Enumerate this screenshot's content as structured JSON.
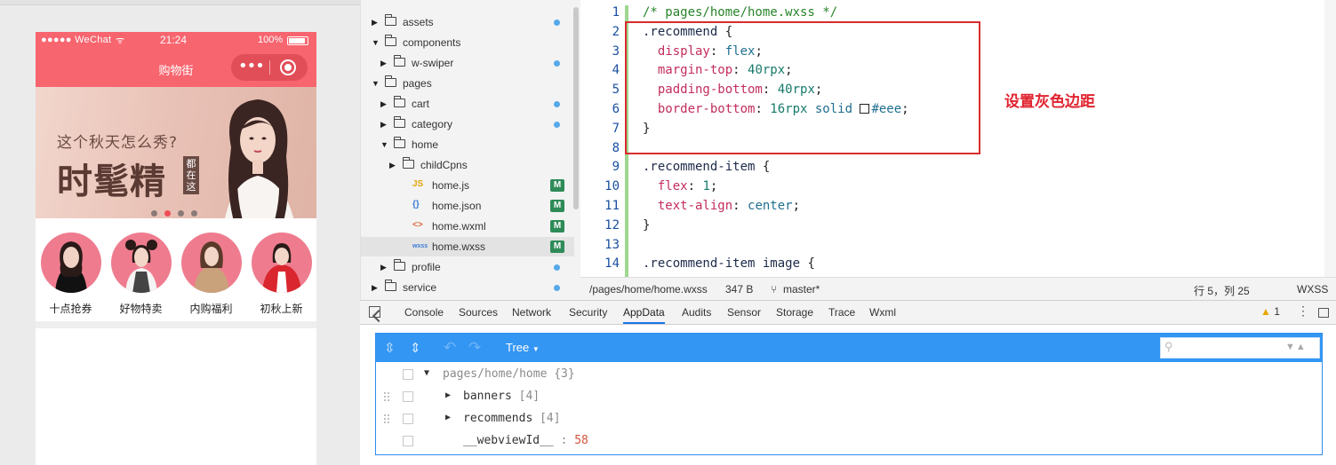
{
  "simulator": {
    "status_bar": {
      "carrier": "●●●●● WeChat",
      "wifi": "ᯤ",
      "time": "21:24",
      "battery_pct": "100%"
    },
    "nav_title": "购物街",
    "capsule": {
      "more": "•••"
    },
    "banner": {
      "subtitle": "这个秋天怎么秀?",
      "headline": "时髦精",
      "vertical_text": "都在这",
      "active_dot": 1,
      "dot_count": 4
    },
    "recommends": [
      {
        "label": "十点抢券"
      },
      {
        "label": "好物特卖"
      },
      {
        "label": "内购福利"
      },
      {
        "label": "初秋上新"
      }
    ],
    "colors": {
      "brand": "#f7656f",
      "recommend_avatar_bg": "#ef7c8e"
    }
  },
  "file_tree": {
    "items": [
      {
        "name": "assets",
        "type": "folder",
        "expanded": false,
        "indent": 0,
        "dot": true
      },
      {
        "name": "components",
        "type": "folder",
        "expanded": true,
        "indent": 0,
        "dot": false
      },
      {
        "name": "w-swiper",
        "type": "folder",
        "expanded": false,
        "indent": 1,
        "dot": true
      },
      {
        "name": "pages",
        "type": "folder",
        "expanded": true,
        "indent": 0,
        "dot": false
      },
      {
        "name": "cart",
        "type": "folder",
        "expanded": false,
        "indent": 1,
        "dot": true
      },
      {
        "name": "category",
        "type": "folder",
        "expanded": false,
        "indent": 1,
        "dot": true
      },
      {
        "name": "home",
        "type": "folder",
        "expanded": true,
        "indent": 1,
        "dot": false
      },
      {
        "name": "childCpns",
        "type": "folder",
        "expanded": false,
        "indent": 2,
        "dot": false
      },
      {
        "name": "home.js",
        "type": "file",
        "icon": "JS",
        "indent": 2,
        "badge": "M"
      },
      {
        "name": "home.json",
        "type": "file",
        "icon": "{}",
        "indent": 2,
        "badge": "M"
      },
      {
        "name": "home.wxml",
        "type": "file",
        "icon": "<>",
        "indent": 2,
        "badge": "M"
      },
      {
        "name": "home.wxss",
        "type": "file",
        "icon": "wxss",
        "indent": 2,
        "badge": "M",
        "selected": true
      },
      {
        "name": "profile",
        "type": "folder",
        "expanded": false,
        "indent": 1,
        "dot": true
      },
      {
        "name": "service",
        "type": "folder",
        "expanded": false,
        "indent": 0,
        "dot": true
      }
    ]
  },
  "editor": {
    "lines": [
      {
        "n": "1",
        "tokens": [
          [
            "c-comment",
            "/* pages/home/home.wxss */"
          ]
        ]
      },
      {
        "n": "2",
        "tokens": [
          [
            "c-sel",
            ".recommend "
          ],
          [
            "c-plain",
            "{"
          ]
        ]
      },
      {
        "n": "3",
        "tokens": [
          [
            "c-plain",
            "  "
          ],
          [
            "c-prop",
            "display"
          ],
          [
            "c-plain",
            ": "
          ],
          [
            "c-val",
            "flex"
          ],
          [
            "c-plain",
            ";"
          ]
        ]
      },
      {
        "n": "4",
        "tokens": [
          [
            "c-plain",
            "  "
          ],
          [
            "c-prop",
            "margin-top"
          ],
          [
            "c-plain",
            ": "
          ],
          [
            "c-num",
            "40rpx"
          ],
          [
            "c-plain",
            ";"
          ]
        ]
      },
      {
        "n": "5",
        "tokens": [
          [
            "c-plain",
            "  "
          ],
          [
            "c-prop",
            "padding-bottom"
          ],
          [
            "c-plain",
            ": "
          ],
          [
            "c-num",
            "40rpx"
          ],
          [
            "c-plain",
            ";"
          ]
        ]
      },
      {
        "n": "6",
        "tokens": [
          [
            "c-plain",
            "  "
          ],
          [
            "c-prop",
            "border-bottom"
          ],
          [
            "c-plain",
            ": "
          ],
          [
            "c-num",
            "16rpx "
          ],
          [
            "c-val",
            "solid "
          ],
          [
            "colorbox",
            ""
          ],
          [
            "c-val",
            "#eee"
          ],
          [
            "c-plain",
            ";"
          ]
        ]
      },
      {
        "n": "7",
        "tokens": [
          [
            "c-plain",
            "}"
          ]
        ]
      },
      {
        "n": "8",
        "tokens": []
      },
      {
        "n": "9",
        "tokens": [
          [
            "c-sel",
            ".recommend-item "
          ],
          [
            "c-plain",
            "{"
          ]
        ]
      },
      {
        "n": "10",
        "tokens": [
          [
            "c-plain",
            "  "
          ],
          [
            "c-prop",
            "flex"
          ],
          [
            "c-plain",
            ": "
          ],
          [
            "c-num",
            "1"
          ],
          [
            "c-plain",
            ";"
          ]
        ]
      },
      {
        "n": "11",
        "tokens": [
          [
            "c-plain",
            "  "
          ],
          [
            "c-prop",
            "text-align"
          ],
          [
            "c-plain",
            ": "
          ],
          [
            "c-val",
            "center"
          ],
          [
            "c-plain",
            ";"
          ]
        ]
      },
      {
        "n": "12",
        "tokens": [
          [
            "c-plain",
            "}"
          ]
        ]
      },
      {
        "n": "13",
        "tokens": []
      },
      {
        "n": "14",
        "tokens": [
          [
            "c-sel",
            ".recommend-item image "
          ],
          [
            "c-plain",
            "{"
          ]
        ]
      }
    ],
    "annotation": "设置灰色边距",
    "status": {
      "path": "/pages/home/home.wxss",
      "size": "347 B",
      "branch": "master*",
      "cursor": "行 5，列 25",
      "lang": "WXSS"
    }
  },
  "devtools": {
    "tabs": [
      "Console",
      "Sources",
      "Network",
      "Security",
      "AppData",
      "Audits",
      "Sensor",
      "Storage",
      "Trace",
      "Wxml"
    ],
    "active_tab": "AppData",
    "warnings": "1",
    "appdata": {
      "mode": "Tree",
      "root": {
        "key": "pages/home/home",
        "count": "{3}"
      },
      "children": [
        {
          "key": "banners",
          "count": "[4]"
        },
        {
          "key": "recommends",
          "count": "[4]"
        },
        {
          "key": "__webviewId__",
          "value": "58"
        }
      ]
    }
  }
}
